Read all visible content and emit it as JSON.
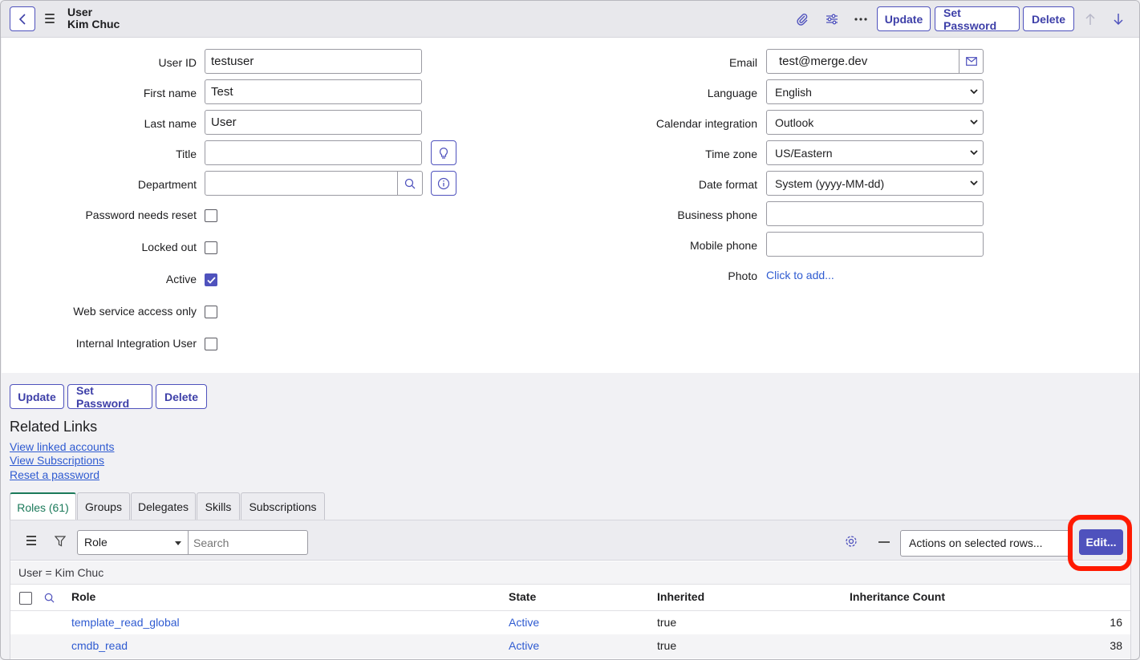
{
  "header": {
    "table_label": "User",
    "record_name": "Kim Chuc",
    "update_label": "Update",
    "set_password_label": "Set Password",
    "delete_label": "Delete"
  },
  "form": {
    "left": {
      "user_id": {
        "label": "User ID",
        "value": "testuser"
      },
      "first_name": {
        "label": "First name",
        "value": "Test"
      },
      "last_name": {
        "label": "Last name",
        "value": "User"
      },
      "title": {
        "label": "Title",
        "value": ""
      },
      "department": {
        "label": "Department",
        "value": ""
      },
      "password_needs_reset": {
        "label": "Password needs reset",
        "checked": false
      },
      "locked_out": {
        "label": "Locked out",
        "checked": false
      },
      "active": {
        "label": "Active",
        "checked": true
      },
      "web_service_access_only": {
        "label": "Web service access only",
        "checked": false
      },
      "internal_integration_user": {
        "label": "Internal Integration User",
        "checked": false
      }
    },
    "right": {
      "email": {
        "label": "Email",
        "value": "test@merge.dev"
      },
      "language": {
        "label": "Language",
        "value": "English"
      },
      "calendar_integration": {
        "label": "Calendar integration",
        "value": "Outlook"
      },
      "time_zone": {
        "label": "Time zone",
        "value": "US/Eastern"
      },
      "date_format": {
        "label": "Date format",
        "value": "System (yyyy-MM-dd)"
      },
      "business_phone": {
        "label": "Business phone",
        "value": ""
      },
      "mobile_phone": {
        "label": "Mobile phone",
        "value": ""
      },
      "photo": {
        "label": "Photo",
        "link": "Click to add..."
      }
    }
  },
  "bottom_buttons": {
    "update_label": "Update",
    "set_password_label": "Set Password",
    "delete_label": "Delete"
  },
  "related_links": {
    "heading": "Related Links",
    "items": [
      "View linked accounts",
      "View Subscriptions",
      "Reset a password"
    ]
  },
  "tabs": [
    "Roles (61)",
    "Groups",
    "Delegates",
    "Skills",
    "Subscriptions"
  ],
  "list": {
    "search_field": "Role",
    "search_placeholder": "Search",
    "actions_select": "Actions on selected rows...",
    "edit_label": "Edit...",
    "filter_breadcrumb": "User = Kim Chuc",
    "columns": [
      "Role",
      "State",
      "Inherited",
      "Inheritance Count"
    ],
    "rows": [
      {
        "role": "template_read_global",
        "state": "Active",
        "inherited": "true",
        "count": "16"
      },
      {
        "role": "cmdb_read",
        "state": "Active",
        "inherited": "true",
        "count": "38"
      }
    ]
  },
  "colors": {
    "accent": "#4f52bd",
    "link": "#2f5bd1",
    "active_tab": "#1b7a5a",
    "highlight": "#ff1a00"
  }
}
